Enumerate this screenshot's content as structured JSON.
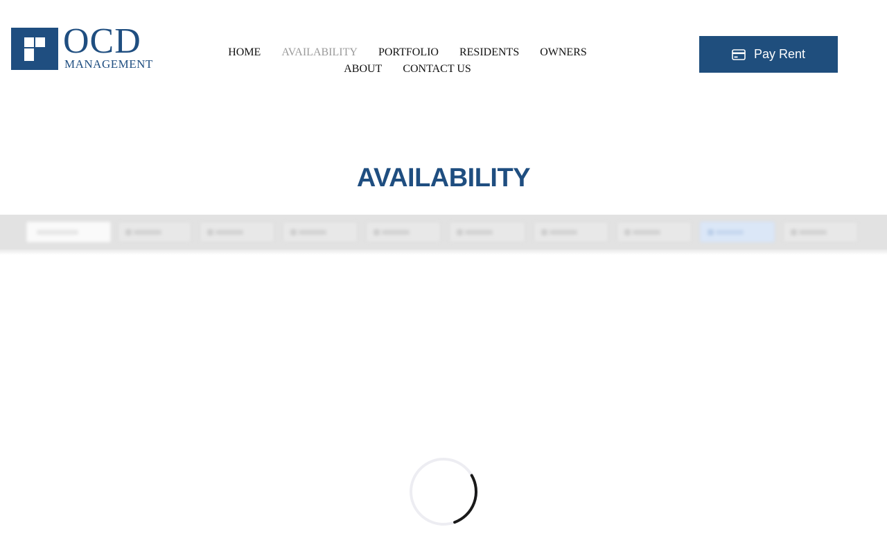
{
  "brand": {
    "name": "OCD",
    "subtitle": "MANAGEMENT",
    "color": "#1f4e80"
  },
  "nav": {
    "items": [
      {
        "label": "HOME",
        "active": false
      },
      {
        "label": "AVAILABILITY",
        "active": true
      },
      {
        "label": "PORTFOLIO",
        "active": false
      },
      {
        "label": "RESIDENTS",
        "active": false
      },
      {
        "label": "OWNERS",
        "active": false
      },
      {
        "label": "ABOUT",
        "active": false
      },
      {
        "label": "CONTACT US",
        "active": false
      }
    ],
    "active_color": "#9a9a9a"
  },
  "header": {
    "pay_rent_label": "Pay Rent",
    "pay_rent_icon": "credit-card-icon",
    "button_color": "#1f4e7d"
  },
  "page": {
    "title": "AVAILABILITY"
  },
  "filter_bar": {
    "state": "loading",
    "control_count": 11
  },
  "loading": {
    "indicator": "spinner-icon"
  }
}
